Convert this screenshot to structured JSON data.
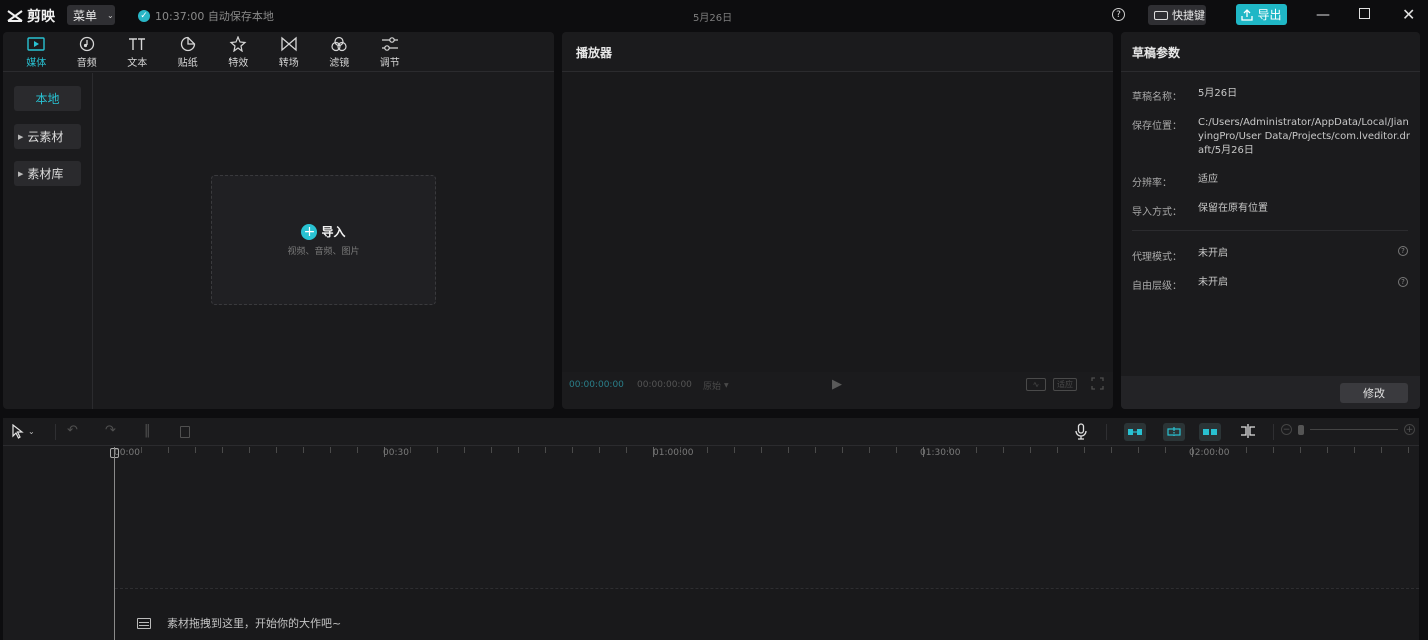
{
  "titlebar": {
    "app_name": "剪映",
    "menu_label": "菜单",
    "autosave_text": "10:37:00 自动保存本地",
    "project_name": "5月26日",
    "shortcut_label": "快捷键",
    "export_label": "导出"
  },
  "media": {
    "tabs": [
      {
        "label": "媒体",
        "icon": "media-icon",
        "active": true
      },
      {
        "label": "音频",
        "icon": "audio-icon"
      },
      {
        "label": "文本",
        "icon": "text-icon"
      },
      {
        "label": "贴纸",
        "icon": "sticker-icon"
      },
      {
        "label": "特效",
        "icon": "effects-icon"
      },
      {
        "label": "转场",
        "icon": "transition-icon"
      },
      {
        "label": "滤镜",
        "icon": "filter-icon"
      },
      {
        "label": "调节",
        "icon": "adjust-icon"
      }
    ],
    "sidebar": [
      {
        "label": "本地"
      },
      {
        "label": "云素材"
      },
      {
        "label": "素材库"
      }
    ],
    "import_label": "导入",
    "import_sub": "视频、音频、图片"
  },
  "player": {
    "title": "播放器",
    "current_time": "00:00:00:00",
    "total_time": "00:00:00:00",
    "ratio_label": "原始",
    "fit_label": "适应"
  },
  "draft": {
    "title": "草稿参数",
    "name_label": "草稿名称：",
    "name_value": "5月26日",
    "location_label": "保存位置：",
    "location_value": "C:/Users/Administrator/AppData/Local/JianyingPro/User Data/Projects/com.lveditor.draft/5月26日",
    "resolution_label": "分辨率：",
    "resolution_value": "适应",
    "import_mode_label": "导入方式：",
    "import_mode_value": "保留在原有位置",
    "proxy_label": "代理模式：",
    "proxy_value": "未开启",
    "layer_label": "自由层级：",
    "layer_value": "未开启",
    "modify_label": "修改"
  },
  "timeline": {
    "ruler": [
      "00:00",
      "00:30",
      "01:00:00",
      "01:30:00",
      "02:00:00"
    ],
    "hint": "素材拖拽到这里，开始你的大作吧~"
  },
  "colors": {
    "accent": "#29c2d2",
    "panel": "#1b1b1d",
    "background": "#0d0d0f"
  }
}
